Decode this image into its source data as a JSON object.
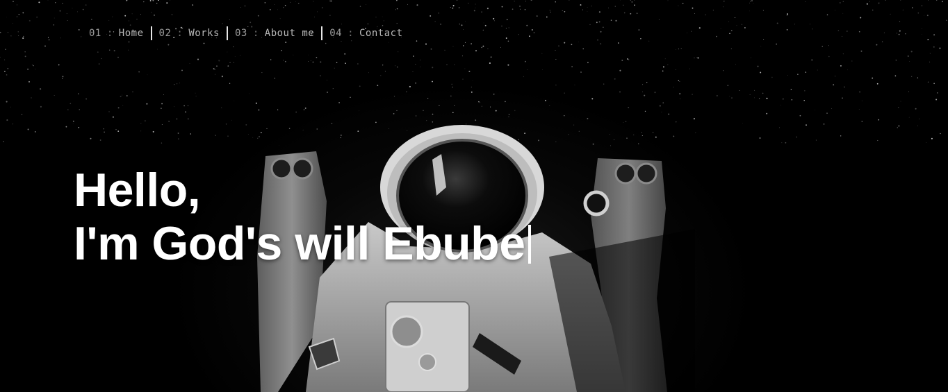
{
  "nav": {
    "items": [
      {
        "number": "01",
        "separator": ":",
        "label": "Home"
      },
      {
        "number": "02",
        "separator": ":",
        "label": "Works"
      },
      {
        "number": "03",
        "separator": ":",
        "label": "About me"
      },
      {
        "number": "04",
        "separator": ":",
        "label": "Contact"
      }
    ]
  },
  "hero": {
    "greeting": "Hello,",
    "intro": "I'm God's will Ebube"
  },
  "background": {
    "subject": "astronaut-photo",
    "colors": {
      "sky": "#000000",
      "stars": "#ffffff"
    }
  }
}
